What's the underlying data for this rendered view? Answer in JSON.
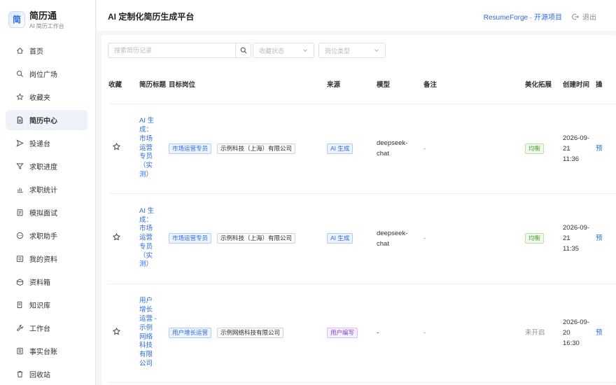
{
  "brand": {
    "name": "简历通",
    "subtitle": "AI 简历工作台",
    "logo": "简"
  },
  "nav": [
    {
      "label": "首页",
      "icon": "home-icon",
      "active": false
    },
    {
      "label": "岗位广场",
      "icon": "search-icon",
      "active": false
    },
    {
      "label": "收藏夹",
      "icon": "star-icon",
      "active": false
    },
    {
      "label": "简历中心",
      "icon": "document-icon",
      "active": true
    },
    {
      "label": "投递台",
      "icon": "send-icon",
      "active": false
    },
    {
      "label": "求职进度",
      "icon": "funnel-icon",
      "active": false
    },
    {
      "label": "求职统计",
      "icon": "bar-chart-icon",
      "active": false
    },
    {
      "label": "模拟面试",
      "icon": "clipboard-icon",
      "active": false
    },
    {
      "label": "求职助手",
      "icon": "chat-icon",
      "active": false
    },
    {
      "label": "我的资料",
      "icon": "profile-icon",
      "active": false
    },
    {
      "label": "资料箱",
      "icon": "box-icon",
      "active": false
    },
    {
      "label": "知识库",
      "icon": "book-icon",
      "active": false
    },
    {
      "label": "工作台",
      "icon": "wrench-icon",
      "active": false
    },
    {
      "label": "事实台账",
      "icon": "ledger-icon",
      "active": false
    },
    {
      "label": "回收站",
      "icon": "trash-icon",
      "active": false
    }
  ],
  "header": {
    "title": "AI 定制化简历生成平台",
    "project_link": "ResumeForge · 开源项目",
    "logout": "退出"
  },
  "filters": {
    "search_placeholder": "搜索简历记录",
    "favorite_status_placeholder": "收藏状态",
    "job_type_placeholder": "岗位类型"
  },
  "table": {
    "columns": {
      "favorite": "收藏",
      "title": "简历标题",
      "target": "目标岗位",
      "source": "来源",
      "model": "模型",
      "note": "备注",
      "beautify": "美化拓展",
      "created": "创建时间",
      "action": "操"
    },
    "rows": [
      {
        "title": "AI 生成：市场运营专员（实测）",
        "position": "市场运营专员",
        "company": "示例科技（上海）有限公司",
        "source": "AI 生成",
        "source_style": "blue",
        "model": "deepseek-chat",
        "note": "-",
        "beautify": "均衡",
        "beautify_style": "green",
        "date": "2026-09-21",
        "time": "11:36",
        "action": "预"
      },
      {
        "title": "AI 生成：市场运营专员（实测）",
        "position": "市场运营专员",
        "company": "示例科技（上海）有限公司",
        "source": "AI 生成",
        "source_style": "blue",
        "model": "deepseek-chat",
        "note": "-",
        "beautify": "均衡",
        "beautify_style": "green",
        "date": "2026-09-21",
        "time": "11:35",
        "action": "预"
      },
      {
        "title": "用户增长运营 - 示例网络科技有限公司",
        "position": "用户增长运营",
        "company": "示例网络科技有限公司",
        "source": "用户编写",
        "source_style": "purple",
        "model": "-",
        "note": "-",
        "beautify": "未开启",
        "beautify_style": "none",
        "date": "2026-09-20",
        "time": "16:30",
        "action": "预"
      }
    ]
  },
  "colors": {
    "accent": "#2d6bdc",
    "active_nav_bg": "#eef2f9",
    "border": "#dcdfe6"
  }
}
